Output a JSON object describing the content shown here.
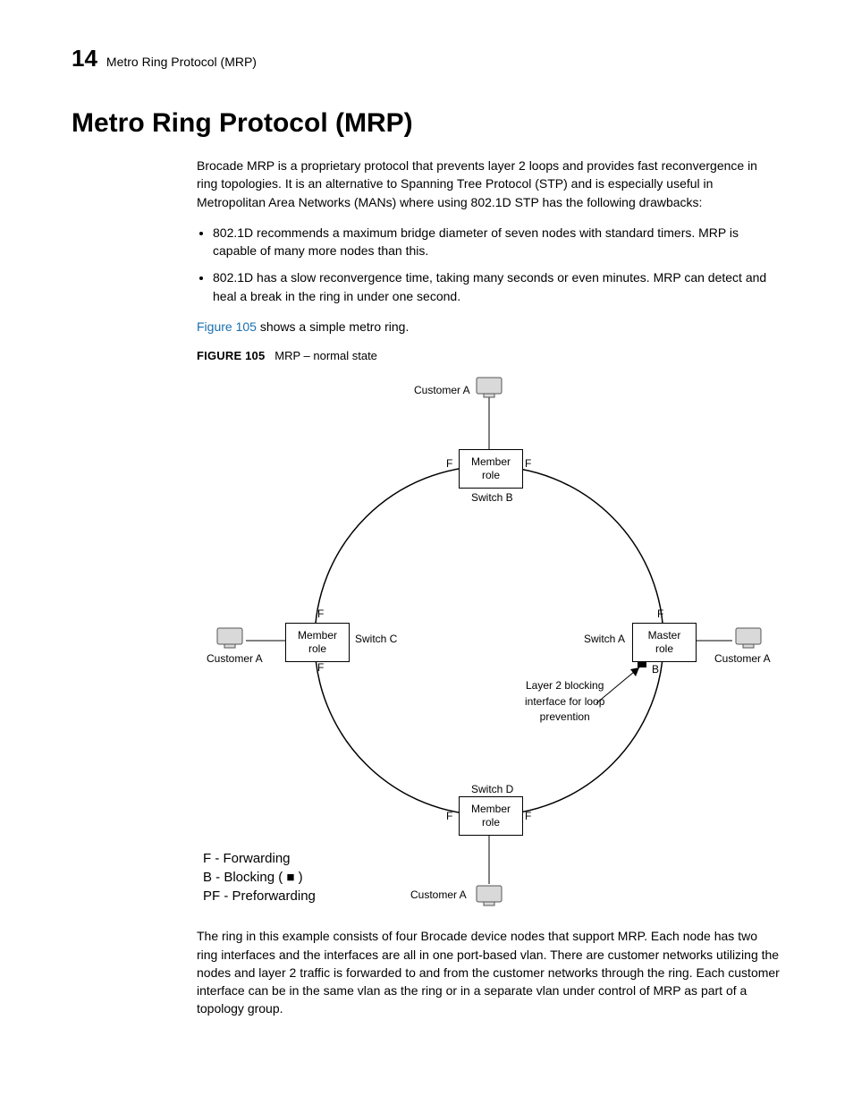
{
  "header": {
    "chapter_number": "14",
    "running_title": "Metro Ring Protocol (MRP)"
  },
  "title": "Metro Ring Protocol (MRP)",
  "intro_para": "Brocade MRP is a proprietary protocol that prevents layer 2 loops and provides fast reconvergence in ring topologies. It is an alternative to Spanning Tree Protocol (STP) and is especially useful in Metropolitan Area Networks (MANs) where using 802.1D STP has the following drawbacks:",
  "bullets": [
    "802.1D recommends a maximum bridge diameter of seven nodes with standard timers. MRP is capable of many more nodes than this.",
    "802.1D has a slow reconvergence time, taking many seconds or even minutes. MRP can detect and heal a break in the ring in under one second."
  ],
  "fig_ref_sentence_pre": "Figure 105",
  "fig_ref_sentence_post": " shows a simple metro ring.",
  "figure": {
    "label": "FIGURE 105",
    "caption": "MRP – normal state",
    "nodes": {
      "top": {
        "role": "Member role",
        "switch": "Switch B"
      },
      "right": {
        "role": "Master role",
        "switch": "Switch A"
      },
      "bottom": {
        "role": "Member role",
        "switch": "Switch D"
      },
      "left": {
        "role": "Member role",
        "switch": "Switch C"
      }
    },
    "customers": {
      "top": "Customer A",
      "right": "Customer A",
      "bottom": "Customer A",
      "left": "Customer A"
    },
    "port_labels": {
      "F": "F",
      "B": "B"
    },
    "blocking_note": "Layer 2 blocking\ninterface for loop\nprevention",
    "legend": {
      "line1": "F - Forwarding",
      "line2": "B - Blocking ( ■ )",
      "line3": "PF - Preforwarding"
    }
  },
  "closing_para": "The ring in this example consists of four Brocade device nodes that support MRP. Each node has two ring interfaces and the interfaces are all in one port-based vlan. There are customer networks utilizing the nodes and layer 2 traffic is forwarded to and from the customer networks through the ring. Each customer interface can be in the same vlan as the ring or in a separate vlan under control of MRP as part of a topology group."
}
